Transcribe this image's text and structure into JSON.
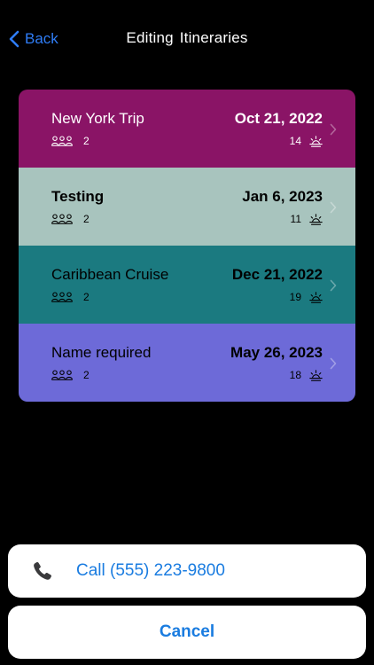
{
  "nav": {
    "back_label": "Back",
    "title": "Editing  Itineraries"
  },
  "itineraries": [
    {
      "name": "New York Trip",
      "date": "Oct 21, 2022",
      "people": "2",
      "days": "14",
      "color": "#8a1466",
      "text_color": "#ffffff",
      "name_weight": "normal"
    },
    {
      "name": "Testing",
      "date": "Jan 6, 2023",
      "people": "2",
      "days": "11",
      "color": "#a8c4be",
      "text_color": "#000000",
      "name_weight": "bold"
    },
    {
      "name": "Caribbean Cruise",
      "date": "Dec 21, 2022",
      "people": "2",
      "days": "19",
      "color": "#1b7a80",
      "text_color": "#000000",
      "name_weight": "normal"
    },
    {
      "name": "Name required",
      "date": "May 26, 2023",
      "people": "2",
      "days": "18",
      "color": "#6d6ad8",
      "text_color": "#000000",
      "name_weight": "normal"
    }
  ],
  "actions": {
    "call_label": "Call (555) 223-9800",
    "cancel_label": "Cancel"
  },
  "colors": {
    "accent": "#1a7ce0",
    "nav_accent": "#2f7df6",
    "background": "#000000"
  },
  "icons": {
    "back": "chevron-left-icon",
    "people": "people-icon",
    "days": "sunrise-icon",
    "row_chevron": "chevron-right-icon",
    "call": "phone-icon"
  }
}
